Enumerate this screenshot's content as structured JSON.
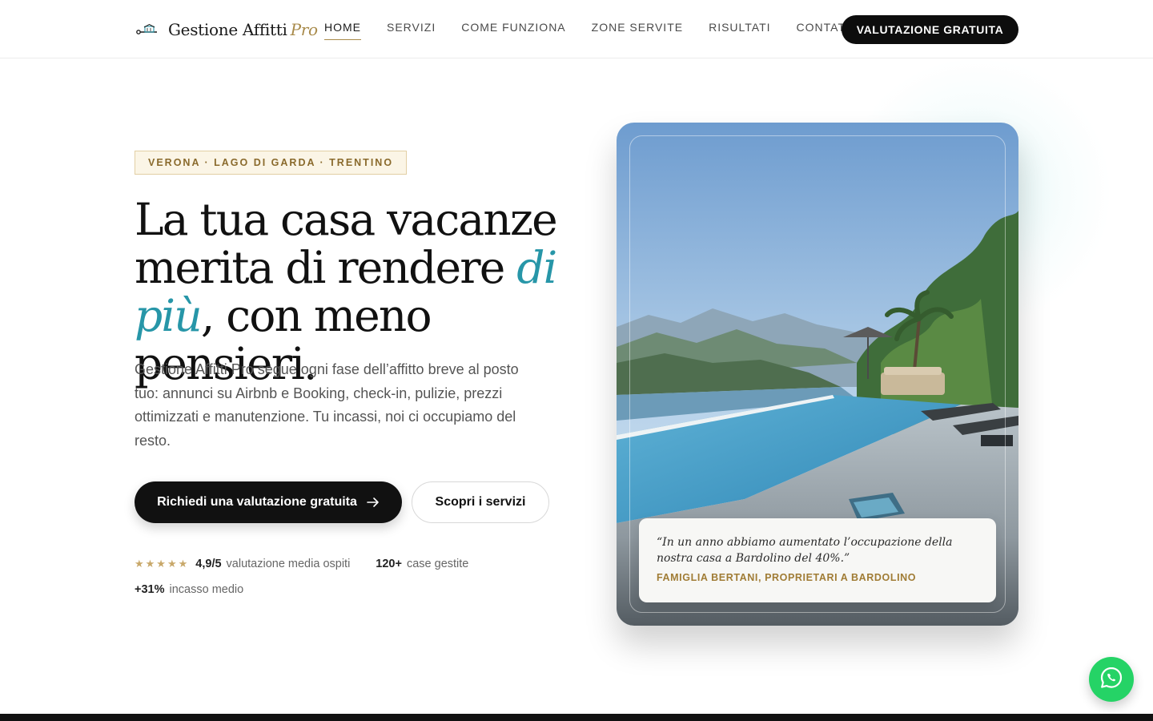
{
  "brand": {
    "name": "Gestione Affitti",
    "suffix": "Pro"
  },
  "nav": {
    "items": [
      {
        "label": "HOME",
        "active": true
      },
      {
        "label": "SERVIZI"
      },
      {
        "label": "COME FUNZIONA"
      },
      {
        "label": "ZONE SERVITE"
      },
      {
        "label": "RISULTATI"
      },
      {
        "label": "CONTATTI"
      }
    ],
    "cta_label": "VALUTAZIONE GRATUITA"
  },
  "hero": {
    "tag": "VERONA · LAGO DI GARDA · TRENTINO",
    "headline_part1": "La tua casa vacanze merita di rendere ",
    "headline_accent": "di più",
    "headline_part2": ", con meno pensieri.",
    "lead": "Gestione Affitti Pro segue ogni fase dell’affitto breve al posto tuo: annunci su Airbnb e Booking, check-in, pulizie, prezzi ottimizzati e manutenzione. Tu incassi, noi ci occupiamo del resto.",
    "primary_button": "Richiedi una valutazione gratuita",
    "secondary_button": "Scopri i servizi",
    "stats": {
      "stars": "★★★★★",
      "rating_rank": 4.9,
      "rating_value": "4,9/5",
      "rating_label": "valutazione media ospiti",
      "homes_value": "120+",
      "homes_label": "case gestite",
      "income_value": "+31%",
      "income_label": "incasso medio"
    }
  },
  "testimonial": {
    "quote": "“In un anno abbiamo aumentato l’occupazione della nostra casa a Bardolino del 40%.”",
    "author": "FAMIGLIA BERTANI, PROPRIETARI A BARDOLINO"
  },
  "colors": {
    "accent_teal": "#2796a8",
    "accent_gold": "#a88a4a",
    "dark": "#111111",
    "whatsapp": "#25d366"
  },
  "icons": {
    "arrow": "arrow-right-icon",
    "whatsapp": "whatsapp-icon",
    "logo": "house-logo-icon"
  }
}
